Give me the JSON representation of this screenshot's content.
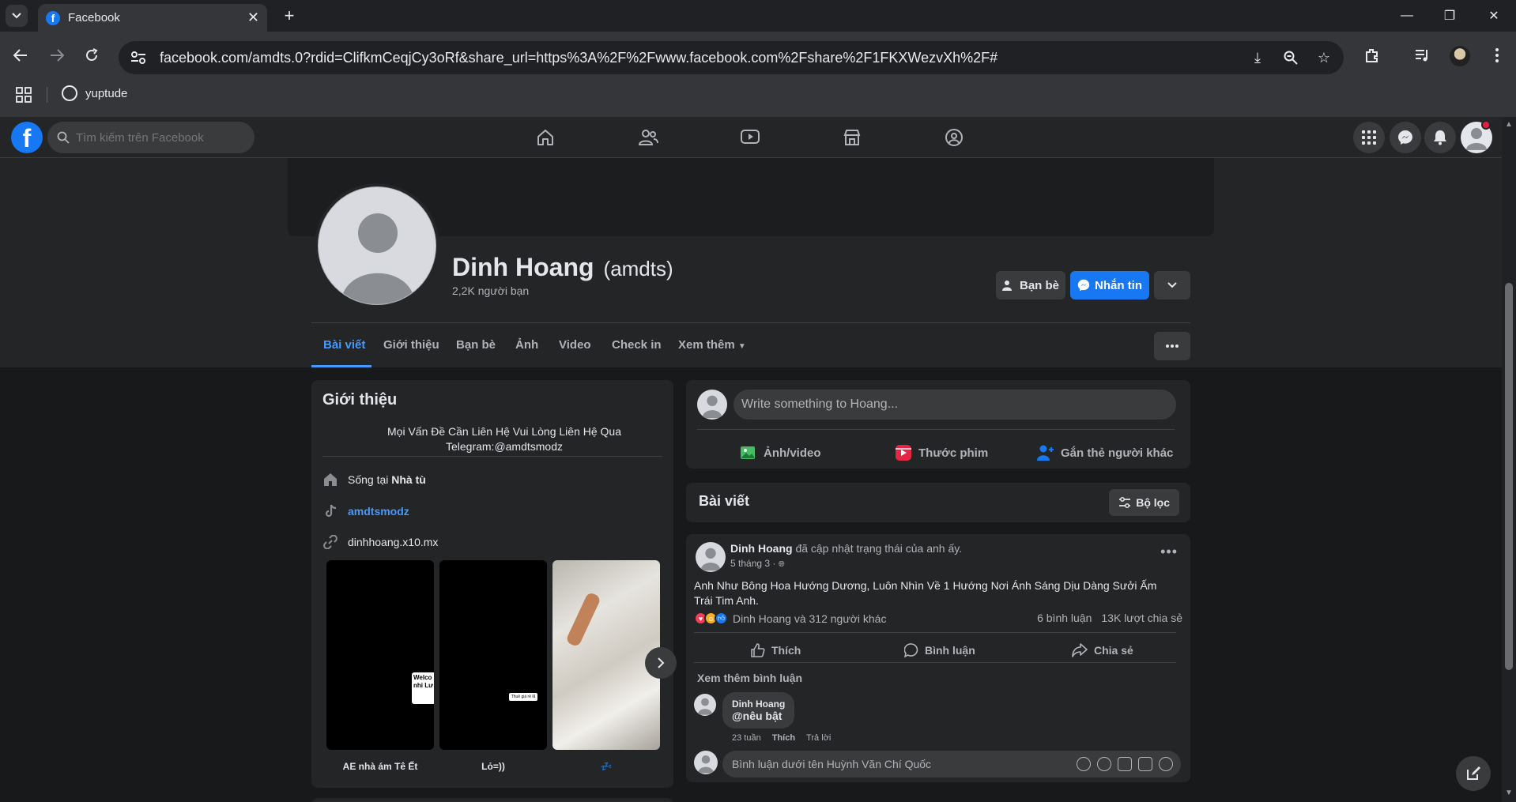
{
  "browser": {
    "tab_title": "Facebook",
    "url": "facebook.com/amdts.0?rdid=ClifkmCeqjCy3oRf&share_url=https%3A%2F%2Fwww.facebook.com%2Fshare%2F1FKXWezvXh%2F#",
    "bookmark": "yuptude"
  },
  "fb": {
    "search_placeholder": "Tìm kiếm trên Facebook"
  },
  "profile": {
    "name": "Dinh Hoang",
    "nickname": "(amdts)",
    "friends": "2,2K người bạn",
    "btn_friends": "Bạn bè",
    "btn_message": "Nhắn tin",
    "tabs": [
      "Bài viết",
      "Giới thiệu",
      "Bạn bè",
      "Ảnh",
      "Video",
      "Check in",
      "Xem thêm"
    ]
  },
  "intro": {
    "title": "Giới thiệu",
    "bio_line1": "Mọi Vấn Đề Cần Liên Hệ Vui Lòng Liên Hệ Qua",
    "bio_line2": "Telegram:@amdtsmodz",
    "lives_prefix": "Sống tại",
    "lives_place": "Nhà tù",
    "tiktok": "amdtsmodz",
    "website": "dinhhoang.x10.mx",
    "thumb_text_1": "Welco nhi Lư",
    "thumb_text_2": "Thuê giá rẻ lắ",
    "captions": [
      "AE nhà ám Tê Ết",
      "Lỏ=))",
      "💤"
    ]
  },
  "composer": {
    "placeholder": "Write something to Hoang...",
    "photo": "Ảnh/video",
    "reel": "Thước phim",
    "tag": "Gắn thẻ người khác"
  },
  "posts_header": {
    "title": "Bài viết",
    "filter": "Bộ lọc"
  },
  "post": {
    "author": "Dinh Hoang",
    "action": "đã cập nhật trạng thái của anh ấy.",
    "time": "5 tháng 3 ·",
    "text": "Anh Như Bông Hoa Hướng Dương, Luôn Nhìn Về 1 Hướng Nơi Ánh Sáng Dịu Dàng Sưởi Ấm Trái Tim Anh.",
    "reactions": "Dinh Hoang và 312 người khác",
    "comments_count": "6 bình luận",
    "shares_count": "13K lượt chia sẻ",
    "like": "Thích",
    "comment": "Bình luận",
    "share": "Chia sẻ",
    "see_more": "Xem thêm bình luận",
    "comment_author": "Dinh Hoang",
    "comment_text": "@nêu bật",
    "comment_time": "23 tuần",
    "comment_like": "Thích",
    "comment_reply": "Trả lời",
    "comment_placeholder": "Bình luận dưới tên Huỳnh Văn Chí Quốc"
  }
}
